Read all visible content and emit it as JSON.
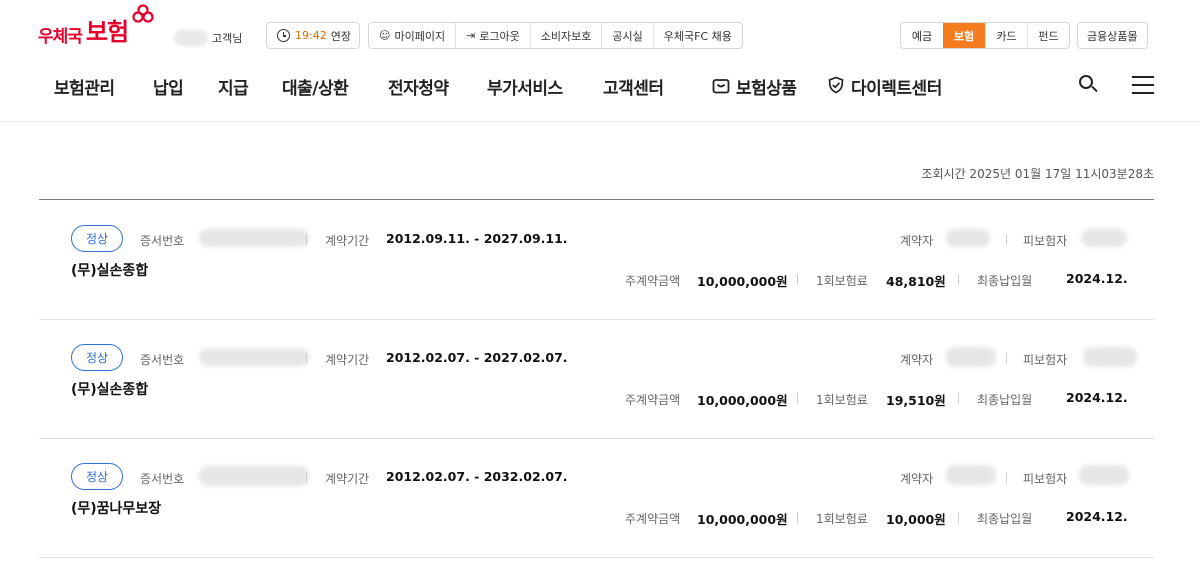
{
  "brand": {
    "name_small": "우체국",
    "name_large": "보험",
    "color": "#e4002b"
  },
  "header": {
    "customer_suffix": "고객님",
    "session": {
      "time": "19:42",
      "extend_label": "연장",
      "time_color": "#e06a00"
    },
    "util_links": [
      {
        "label": "마이페이지",
        "icon": "person-icon"
      },
      {
        "label": "로그아웃",
        "icon": "logout-icon"
      },
      {
        "label": "소비자보호"
      },
      {
        "label": "공시실"
      },
      {
        "label": "우체국FC 채용"
      }
    ],
    "service_tabs": [
      {
        "label": "예금",
        "active": false
      },
      {
        "label": "보험",
        "active": true
      },
      {
        "label": "카드",
        "active": false
      },
      {
        "label": "펀드",
        "active": false
      }
    ],
    "active_tab_color": "#f57c1f",
    "financial_products_label": "금융상품몰"
  },
  "nav": {
    "items": [
      {
        "label": "보험관리"
      },
      {
        "label": "납입"
      },
      {
        "label": "지급"
      },
      {
        "label": "대출/상환"
      },
      {
        "label": "전자청약"
      },
      {
        "label": "부가서비스"
      },
      {
        "label": "고객센터"
      },
      {
        "label": "보험상품",
        "icon": "shopping-bag-icon"
      },
      {
        "label": "다이렉트센터",
        "icon": "shield-check-icon"
      }
    ],
    "search_icon": "search-icon",
    "menu_icon": "hamburger-menu-icon"
  },
  "query_time": "조회시간 2025년 01월 17일 11시03분28초",
  "labels": {
    "cert_no": "증서번호",
    "period": "계약기간",
    "contractor": "계약자",
    "insured": "피보험자",
    "main_amount": "주계약금액",
    "premium": "1회보험료",
    "last_paid": "최종납입월"
  },
  "status_color": "#2f6fd6",
  "contracts": [
    {
      "status": "정상",
      "period": "2012.09.11. - 2027.09.11.",
      "product": "(무)실손종합",
      "main_amount": "10,000,000원",
      "premium": "48,810원",
      "last_paid": "2024.12."
    },
    {
      "status": "정상",
      "period": "2012.02.07. - 2027.02.07.",
      "product": "(무)실손종합",
      "main_amount": "10,000,000원",
      "premium": "19,510원",
      "last_paid": "2024.12."
    },
    {
      "status": "정상",
      "period": "2012.02.07. - 2032.02.07.",
      "product": "(무)꿈나무보장",
      "main_amount": "10,000,000원",
      "premium": "10,000원",
      "last_paid": "2024.12."
    }
  ]
}
